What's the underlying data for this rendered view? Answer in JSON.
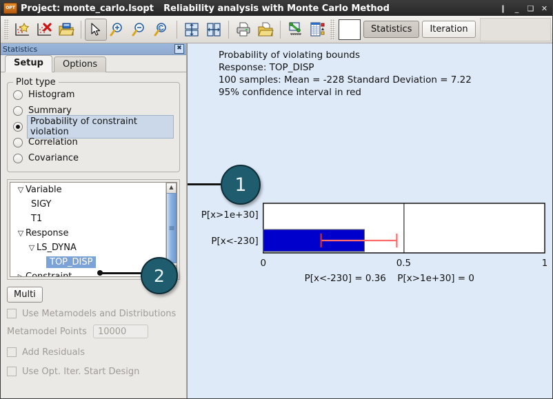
{
  "window": {
    "app_icon": "OPT",
    "project_title": "Project: monte_carlo.lsopt",
    "center_title": "Reliability analysis with Monte Carlo Method",
    "buttons": {
      "restore_small": "❙",
      "minimize": "_",
      "maximize": "❑",
      "close": "✕"
    }
  },
  "toolbar": {
    "icons": [
      {
        "name": "add-point-plot-icon",
        "glyph": "star-scatter"
      },
      {
        "name": "delete-point-plot-icon",
        "glyph": "x-scatter"
      },
      {
        "name": "open-folder-icon",
        "glyph": "folder-open"
      },
      {
        "name": "pointer-tool-icon",
        "glyph": "arrow"
      },
      {
        "name": "zoom-in-icon",
        "glyph": "magnifier-plus"
      },
      {
        "name": "zoom-out-icon",
        "glyph": "magnifier-minus"
      },
      {
        "name": "zoom-reset-icon",
        "glyph": "magnifier-reset"
      },
      {
        "name": "split-horizontal-icon",
        "glyph": "split-h"
      },
      {
        "name": "split-vertical-icon",
        "glyph": "split-v"
      },
      {
        "name": "print-icon",
        "glyph": "printer"
      },
      {
        "name": "save-as-icon",
        "glyph": "folder-save"
      },
      {
        "name": "curve-plot-icon",
        "glyph": "curve"
      },
      {
        "name": "table-view-icon",
        "glyph": "table"
      }
    ],
    "statistics_label": "Statistics",
    "iteration_label": "Iteration"
  },
  "dock": {
    "title": "Statistics",
    "close_label": "✖"
  },
  "tabs": [
    {
      "label": "Setup",
      "selected": true
    },
    {
      "label": "Options",
      "selected": false
    }
  ],
  "plot_type": {
    "legend": "Plot type",
    "options": [
      {
        "label": "Histogram",
        "selected": false
      },
      {
        "label": "Summary",
        "selected": false
      },
      {
        "label": "Probability of constraint violation",
        "selected": true
      },
      {
        "label": "Correlation",
        "selected": false
      },
      {
        "label": "Covariance",
        "selected": false
      }
    ]
  },
  "tree": {
    "nodes": [
      {
        "label": "Variable",
        "indent": 0,
        "twisty": "open",
        "selected": false
      },
      {
        "label": "SIGY",
        "indent": 1,
        "twisty": "none",
        "selected": false
      },
      {
        "label": "T1",
        "indent": 1,
        "twisty": "none",
        "selected": false
      },
      {
        "label": "Response",
        "indent": 0,
        "twisty": "open",
        "selected": false
      },
      {
        "label": "LS_DYNA",
        "indent": 1,
        "twisty": "open",
        "selected": false
      },
      {
        "label": "TOP_DISP",
        "indent": 2,
        "twisty": "none",
        "selected": true
      },
      {
        "label": "Constraint",
        "indent": 0,
        "twisty": "closed",
        "selected": false
      }
    ]
  },
  "controls": {
    "multi_label": "Multi",
    "use_metamodels_label": "Use Metamodels and Distributions",
    "use_metamodels_checked": false,
    "metamodel_points_label": "Metamodel Points",
    "metamodel_points_value": "10000",
    "add_residuals_label": "Add Residuals",
    "add_residuals_checked": false,
    "use_opt_iter_label": "Use Opt. Iter. Start Design",
    "use_opt_iter_checked": false
  },
  "plot_header": {
    "line1": "Probability of violating bounds",
    "line2": "Response: TOP_DISP",
    "line3": "100 samples: Mean = -228   Standard Deviation = 7.22",
    "line4": "95% confidence interval in red"
  },
  "callouts": [
    {
      "number": "1"
    },
    {
      "number": "2"
    }
  ],
  "chart_data": {
    "type": "bar",
    "orientation": "horizontal",
    "title": "Probability of violating bounds",
    "subtitle": "Response: TOP_DISP",
    "categories": [
      "P[x>1e+30]",
      "P[x<-230]"
    ],
    "values": [
      0,
      0.36
    ],
    "bar_color": "#0000cc",
    "error_bars": [
      {
        "category": "P[x<-230]",
        "low": 0.205,
        "high": 0.525,
        "color": "#ff6666",
        "label": "95% confidence interval in red"
      }
    ],
    "xlabel": "",
    "ylabel": "",
    "xlim": [
      0,
      1
    ],
    "xticks": [
      0,
      0.5,
      1
    ],
    "xticklabels": [
      "0",
      "0.5",
      "1"
    ],
    "grid": true,
    "annotations": [
      "P[x<-230] = 0.36",
      "P[x>1e+30] = 0"
    ],
    "samples": 100,
    "mean": -228,
    "standard_deviation": 7.22
  }
}
